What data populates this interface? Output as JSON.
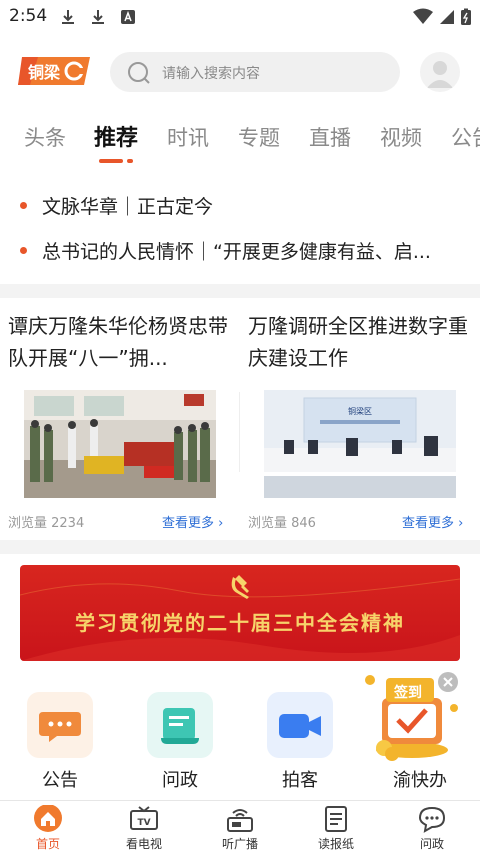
{
  "status_bar": {
    "time": "2:54"
  },
  "header": {
    "logo_text": "铜梁",
    "search_placeholder": "请输入搜索内容"
  },
  "tabs": [
    {
      "label": "头条"
    },
    {
      "label": "推荐",
      "active": true
    },
    {
      "label": "时讯"
    },
    {
      "label": "专题"
    },
    {
      "label": "直播"
    },
    {
      "label": "视频"
    },
    {
      "label": "公告"
    }
  ],
  "headlines": [
    {
      "text": "文脉华章｜正古定今"
    },
    {
      "text": "总书记的人民情怀｜“开展更多健康有益、启..."
    }
  ],
  "news": [
    {
      "title": "谭庆万隆朱华伦杨贤忠带队开展“八一”拥...",
      "views": "浏览量 2234",
      "more": "查看更多"
    },
    {
      "title": "万隆调研全区推进数字重庆建设工作",
      "views": "浏览量 846",
      "more": "查看更多"
    }
  ],
  "banner": {
    "text": "学习贯彻党的二十届三中全会精神"
  },
  "quick_entries": [
    {
      "label": "公告",
      "icon": "chat-bubble-icon",
      "color": "#f08a3c"
    },
    {
      "label": "问政",
      "icon": "scroll-icon",
      "color": "#3ec6b3"
    },
    {
      "label": "拍客",
      "icon": "video-camera-icon",
      "color": "#3a7df0"
    },
    {
      "label": "渝快办",
      "icon": ""
    }
  ],
  "signin": {
    "label": "签到"
  },
  "bottom_nav": [
    {
      "label": "首页",
      "icon": "home-icon",
      "active": true
    },
    {
      "label": "看电视",
      "icon": "tv-icon"
    },
    {
      "label": "听广播",
      "icon": "radio-icon"
    },
    {
      "label": "读报纸",
      "icon": "newspaper-icon"
    },
    {
      "label": "问政",
      "icon": "chat-icon"
    }
  ],
  "colors": {
    "accent": "#e8562a",
    "link": "#2f6fd6",
    "banner_red": "#d01c1c",
    "banner_gold": "#f7d36a"
  }
}
